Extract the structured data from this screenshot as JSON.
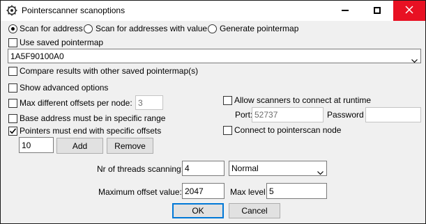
{
  "window": {
    "title": "Pointerscanner scanoptions",
    "buttons": {
      "minimize_icon": "minimize-icon",
      "maximize_icon": "maximize-icon",
      "close_icon": "close-icon"
    }
  },
  "scan_mode": {
    "options": [
      {
        "label": "Scan for address",
        "selected": true
      },
      {
        "label": "Scan for addresses with value",
        "selected": false
      },
      {
        "label": "Generate pointermap",
        "selected": false
      }
    ]
  },
  "saved_pointermap": {
    "use_label": "Use saved pointermap",
    "use_checked": false,
    "address_value": "1A5F90100A0",
    "compare_label": "Compare results with other saved pointermap(s)",
    "compare_checked": false
  },
  "advanced": {
    "show_label": "Show advanced options",
    "show_checked": false,
    "max_offsets_label": "Max different offsets per node:",
    "max_offsets_checked": false,
    "max_offsets_value": "3",
    "base_range_label": "Base address must be in specific range",
    "base_range_checked": false,
    "end_offsets_label": "Pointers must end with specific offsets",
    "end_offsets_checked": true,
    "offset_input_value": "10",
    "add_label": "Add",
    "remove_label": "Remove"
  },
  "network": {
    "allow_runtime_label": "Allow scanners to connect at runtime",
    "allow_runtime_checked": false,
    "port_label": "Port:",
    "port_value": "52737",
    "password_label": "Password",
    "password_value": "",
    "connect_node_label": "Connect to pointerscan node",
    "connect_node_checked": false
  },
  "threads": {
    "label": "Nr of threads scanning:",
    "value": "4",
    "priority_value": "Normal"
  },
  "limits": {
    "max_offset_label": "Maximum offset value:",
    "max_offset_value": "2047",
    "max_level_label": "Max level",
    "max_level_value": "5"
  },
  "footer": {
    "ok_label": "OK",
    "cancel_label": "Cancel"
  }
}
